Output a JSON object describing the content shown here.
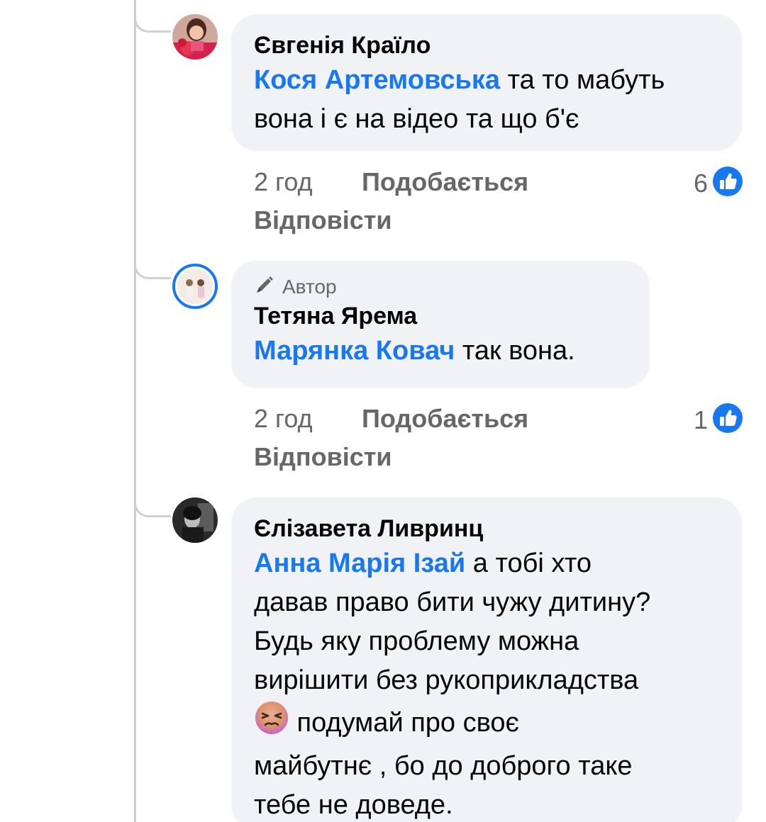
{
  "comments": [
    {
      "author": "Євгенія Країло",
      "mention": "Кося Артемовська",
      "lines": [
        " та то мабуть",
        "вона і є на відео та що б'є"
      ],
      "time": "2 год",
      "like_label": "Подобається",
      "reply_label": "Відповісти",
      "reaction_count": "6",
      "reaction_icon": "like-icon"
    },
    {
      "badge": "Автор",
      "badge_icon": "pencil-icon",
      "author": "Тетяна Ярема",
      "mention": "Марянка Ковач",
      "text": " так вона.",
      "time": "2 год",
      "like_label": "Подобається",
      "reply_label": "Відповісти",
      "reaction_count": "1",
      "reaction_icon": "like-icon"
    },
    {
      "author": "Єлізавета Ливринц",
      "mention": "Анна Марія Ізай",
      "line1": " а тобі хто",
      "line2": "давав право бити чужу дитину?",
      "line3": "Будь яку проблему  можна",
      "line4": "вирішити без рукоприкладства",
      "emoji_icon": "tired-face-emoji-icon",
      "line5": " подумай про своє",
      "line6": "майбутнє , бо до доброго таке",
      "line7": "тебе не доведе."
    }
  ],
  "colors": {
    "mention": "#1877f2",
    "bubble_bg": "#f0f2f5",
    "meta_text": "#65676b",
    "thread_line": "#ced0d4"
  }
}
